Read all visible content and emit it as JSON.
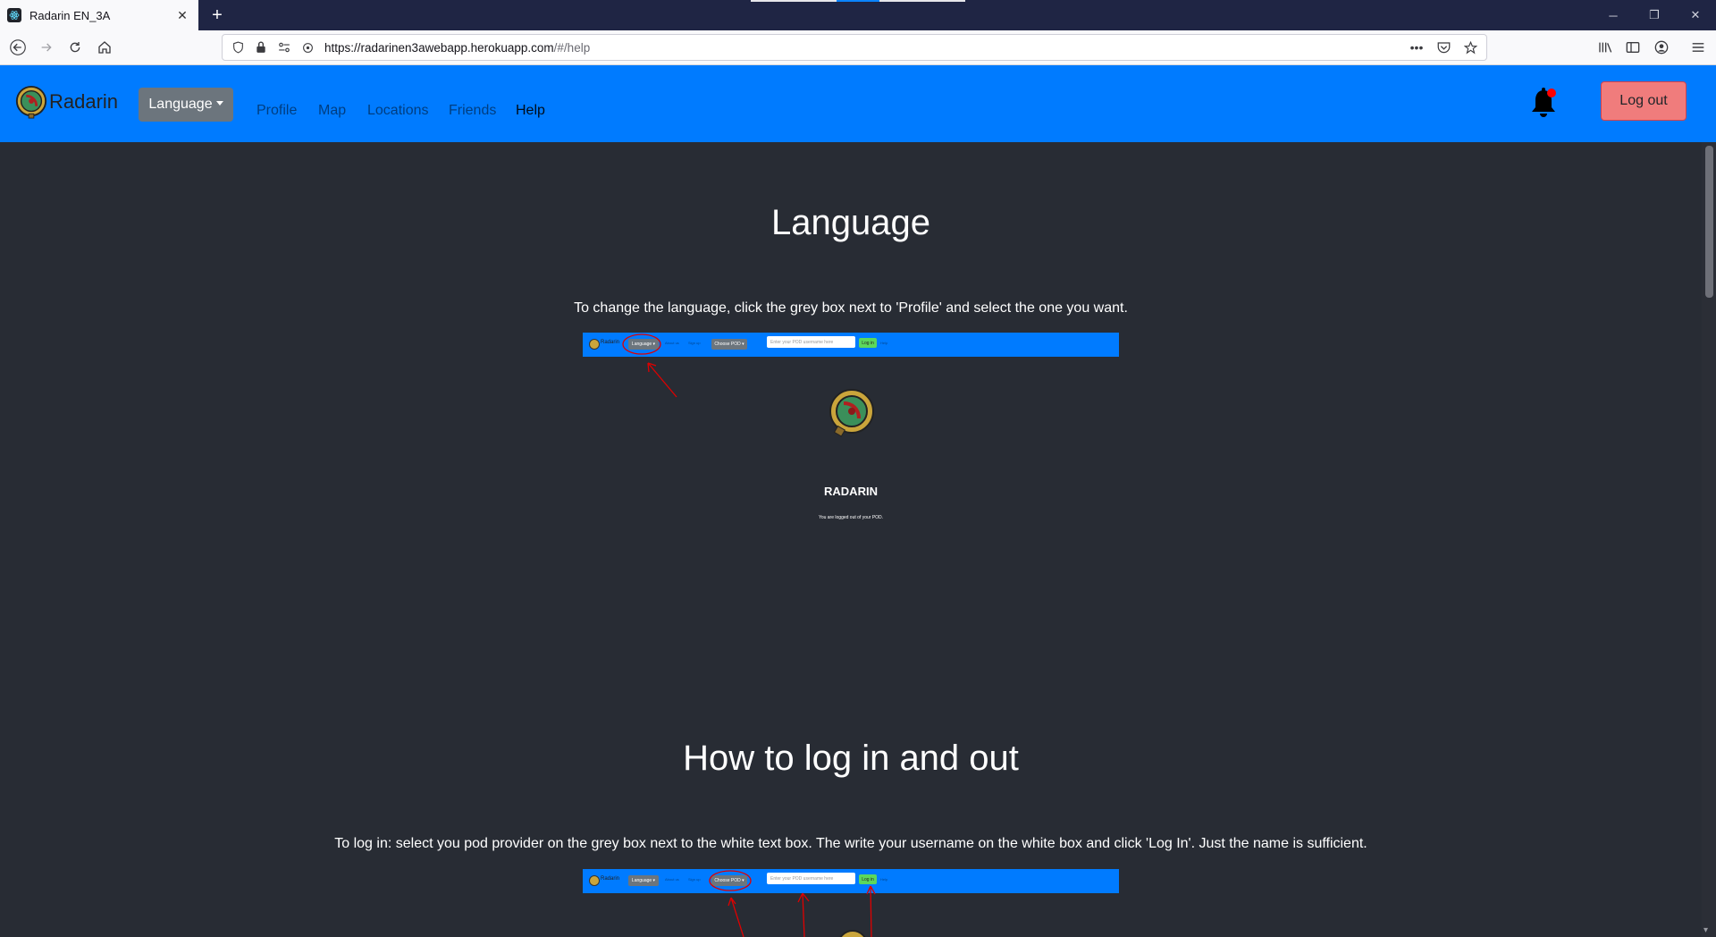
{
  "browser": {
    "tab_title": "Radarin EN_3A",
    "tab_favicon": "react-icon",
    "url_host": "https://radarinen3awebapp.herokuapp.com",
    "url_path": "/#/help",
    "url_more": "•••"
  },
  "app": {
    "brand_name": "Radarin",
    "language_button": "Language",
    "nav": {
      "profile": "Profile",
      "map": "Map",
      "locations": "Locations",
      "friends": "Friends",
      "help": "Help"
    },
    "logout": "Log out",
    "colors": {
      "navbar": "#007bff",
      "background": "#282c34",
      "logout": "#f07c7c",
      "notification_dot": "#ff0000"
    }
  },
  "sections": {
    "language": {
      "title": "Language",
      "text": "To change the language, click the grey box next to 'Profile' and select the one you want."
    },
    "login": {
      "title": "How to log in and out",
      "text": "To log in: select you pod provider on the grey box next to the white text box. The write your username on the white box and click 'Log In'. Just the name is sufficient."
    }
  },
  "screenshot": {
    "brand": "Radarin",
    "language": "Language ▾",
    "about": "About us",
    "signup": "Sign up",
    "choose_pod": "Choose POD ▾",
    "input_placeholder": "Enter your POD username here",
    "login": "Log in",
    "help": "Help",
    "radarin": "RADARIN",
    "logged_out": "You are logged out of your POD."
  }
}
